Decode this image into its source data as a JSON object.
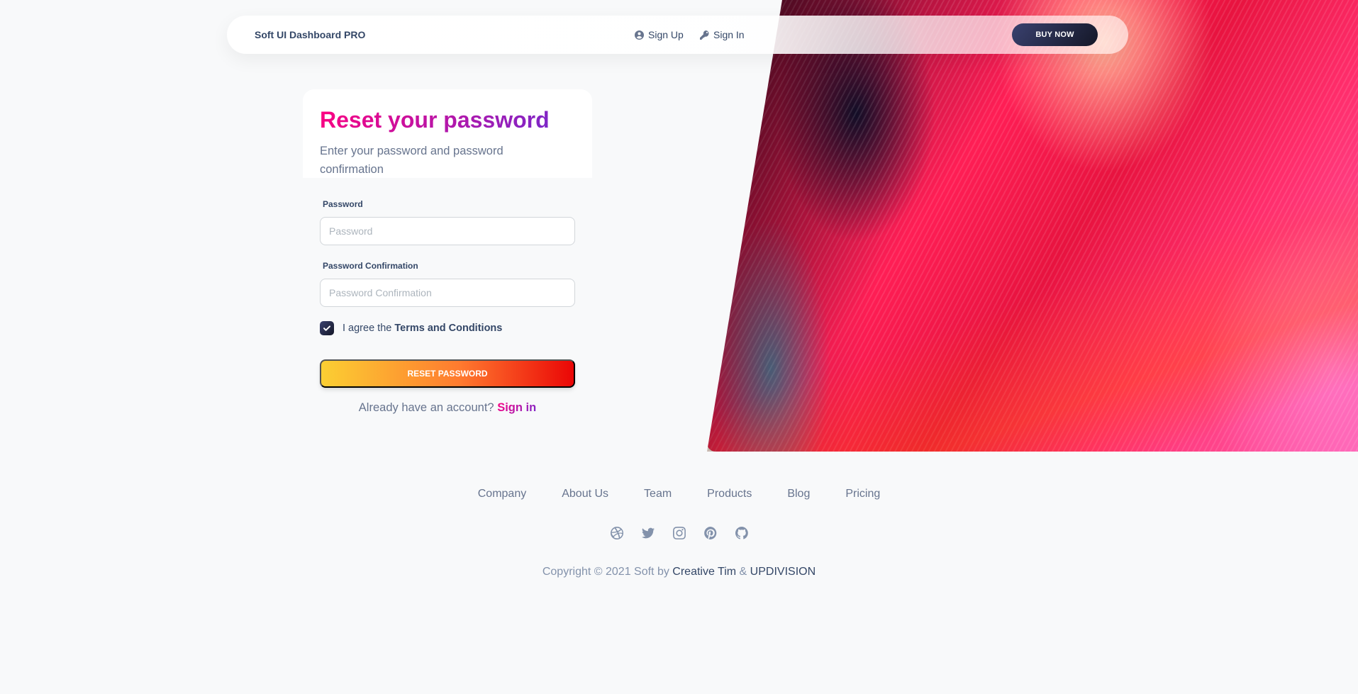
{
  "colors": {
    "brand_gradient": [
      "#7928ca",
      "#ff0080"
    ],
    "reset_button_gradient": [
      "#fbcf33",
      "#ea0606"
    ],
    "dark_button": "#141727",
    "body_background": "#f8f9fa"
  },
  "navbar": {
    "brand": "Soft UI Dashboard PRO",
    "signup_label": "Sign Up",
    "signin_label": "Sign In",
    "buy_label": "BUY NOW",
    "signup_icon": "user-circle-icon",
    "signin_icon": "key-icon"
  },
  "form": {
    "title": "Reset your password",
    "subtitle": "Enter your password and password confirmation",
    "password_label": "Password",
    "password_placeholder": "Password",
    "password_confirm_label": "Password Confirmation",
    "password_confirm_placeholder": "Password Confirmation",
    "agree_prefix": "I agree the",
    "agree_terms": "Terms and Conditions",
    "agree_checked": true,
    "submit_label": "RESET PASSWORD",
    "already_text": "Already have an account?",
    "signin_link": "Sign in"
  },
  "footer": {
    "links": [
      "Company",
      "About Us",
      "Team",
      "Products",
      "Blog",
      "Pricing"
    ],
    "social_icons": [
      "dribbble-icon",
      "twitter-icon",
      "instagram-icon",
      "pinterest-icon",
      "github-icon"
    ],
    "copyright_prefix": "Copyright © 2021 Soft by",
    "copyright_author1": "Creative Tim",
    "copyright_amp": "&",
    "copyright_author2": "UPDIVISION"
  }
}
